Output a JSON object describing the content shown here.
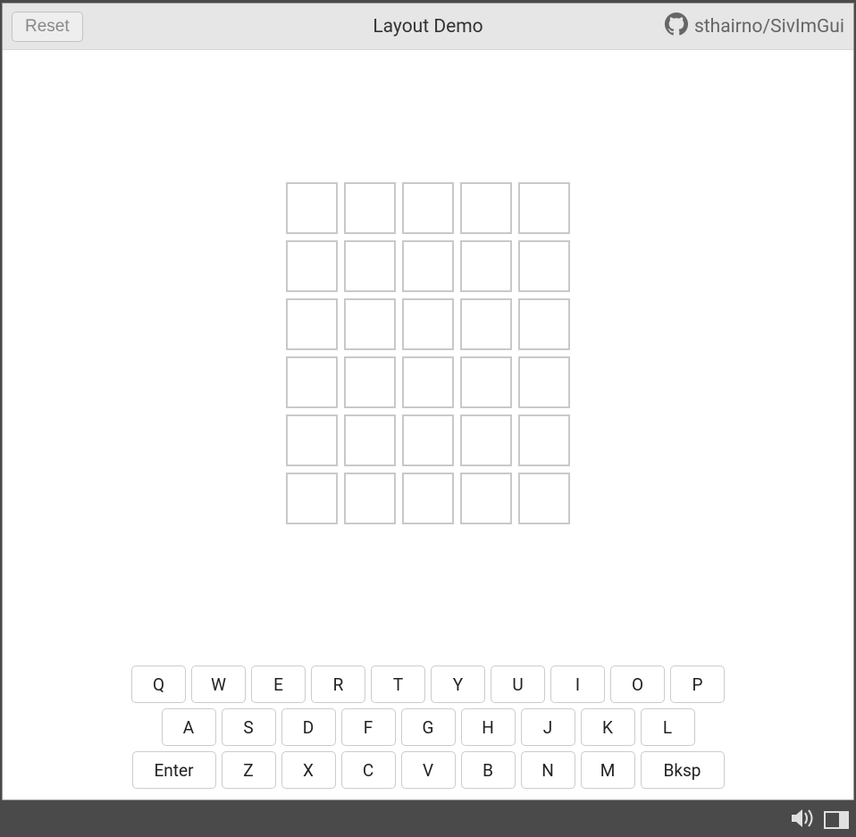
{
  "header": {
    "reset_label": "Reset",
    "title": "Layout Demo",
    "repo_label": "sthairno/SivImGui"
  },
  "grid": {
    "rows": 6,
    "cols": 5,
    "cells": [
      [
        "",
        "",
        "",
        "",
        ""
      ],
      [
        "",
        "",
        "",
        "",
        ""
      ],
      [
        "",
        "",
        "",
        "",
        ""
      ],
      [
        "",
        "",
        "",
        "",
        ""
      ],
      [
        "",
        "",
        "",
        "",
        ""
      ],
      [
        "",
        "",
        "",
        "",
        ""
      ]
    ]
  },
  "keyboard": {
    "rows": [
      [
        "Q",
        "W",
        "E",
        "R",
        "T",
        "Y",
        "U",
        "I",
        "O",
        "P"
      ],
      [
        "A",
        "S",
        "D",
        "F",
        "G",
        "H",
        "J",
        "K",
        "L"
      ],
      [
        "Enter",
        "Z",
        "X",
        "C",
        "V",
        "B",
        "N",
        "M",
        "Bksp"
      ]
    ],
    "wide_keys": [
      "Enter",
      "Bksp"
    ]
  }
}
